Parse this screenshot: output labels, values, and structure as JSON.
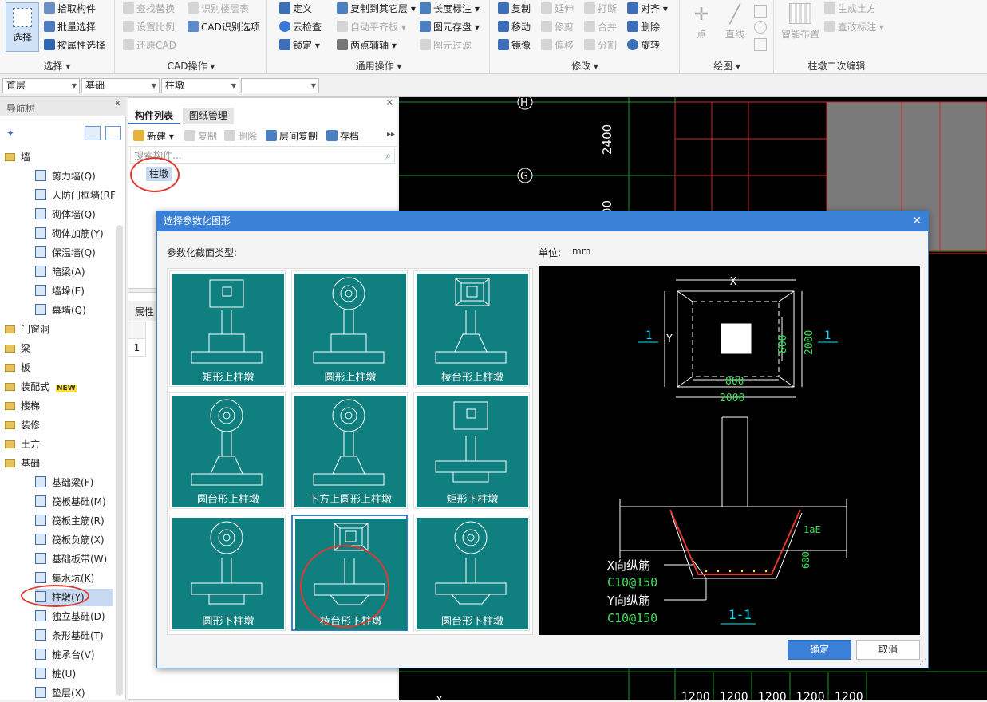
{
  "ribbon": {
    "select": {
      "big_label": "选择",
      "items": [
        "拾取构件",
        "批量选择",
        "按属性选择"
      ],
      "group": "选择"
    },
    "cad": {
      "items": [
        "查找替换",
        "识别楼层表",
        "设置比例",
        "CAD识别选项",
        "还原CAD"
      ],
      "group": "CAD操作"
    },
    "common": {
      "items": [
        "定义",
        "复制到其它层",
        "长度标注",
        "云检查",
        "自动平齐板",
        "图元存盘",
        "锁定",
        "两点辅轴",
        "图元过滤"
      ],
      "group": "通用操作"
    },
    "modify": {
      "items": [
        "复制",
        "延伸",
        "打断",
        "对齐",
        "移动",
        "修剪",
        "合并",
        "删除",
        "镜像",
        "偏移",
        "分割",
        "旋转"
      ],
      "group": "修改"
    },
    "draw": {
      "items": [
        "点",
        "直线"
      ],
      "group": "绘图"
    },
    "secondary": {
      "items": [
        "智能布置",
        "生成土方",
        "查改标注"
      ],
      "group": "柱墩二次编辑"
    }
  },
  "selectors": [
    "首层",
    "基础",
    "柱墩",
    ""
  ],
  "nav": {
    "title": "导航树",
    "items": [
      {
        "label": "墙",
        "type": "folder"
      },
      {
        "label": "剪力墙(Q)",
        "type": "sub"
      },
      {
        "label": "人防门框墙(RF",
        "type": "sub"
      },
      {
        "label": "砌体墙(Q)",
        "type": "sub"
      },
      {
        "label": "砌体加筋(Y)",
        "type": "sub"
      },
      {
        "label": "保温墙(Q)",
        "type": "sub"
      },
      {
        "label": "暗梁(A)",
        "type": "sub"
      },
      {
        "label": "墙垛(E)",
        "type": "sub"
      },
      {
        "label": "幕墙(Q)",
        "type": "sub"
      },
      {
        "label": "门窗洞",
        "type": "folder"
      },
      {
        "label": "梁",
        "type": "folder"
      },
      {
        "label": "板",
        "type": "folder"
      },
      {
        "label": "装配式",
        "type": "folder",
        "badge": "NEW"
      },
      {
        "label": "楼梯",
        "type": "folder"
      },
      {
        "label": "装修",
        "type": "folder"
      },
      {
        "label": "土方",
        "type": "folder"
      },
      {
        "label": "基础",
        "type": "folder"
      },
      {
        "label": "基础梁(F)",
        "type": "sub"
      },
      {
        "label": "筏板基础(M)",
        "type": "sub"
      },
      {
        "label": "筏板主筋(R)",
        "type": "sub"
      },
      {
        "label": "筏板负筋(X)",
        "type": "sub"
      },
      {
        "label": "基础板带(W)",
        "type": "sub"
      },
      {
        "label": "集水坑(K)",
        "type": "sub"
      },
      {
        "label": "柱墩(Y)",
        "type": "sub",
        "selected": true
      },
      {
        "label": "独立基础(D)",
        "type": "sub"
      },
      {
        "label": "条形基础(T)",
        "type": "sub"
      },
      {
        "label": "桩承台(V)",
        "type": "sub"
      },
      {
        "label": "桩(U)",
        "type": "sub"
      },
      {
        "label": "垫层(X)",
        "type": "sub"
      }
    ]
  },
  "comp": {
    "tabs": [
      "构件列表",
      "图纸管理"
    ],
    "toolbar": [
      "新建",
      "复制",
      "删除",
      "层间复制",
      "存档"
    ],
    "search_placeholder": "搜索构件...",
    "item": "柱墩"
  },
  "prop": {
    "header": "属性",
    "row": "1"
  },
  "canvas": {
    "axis_h": "H",
    "axis_g": "G",
    "dim_2400": "2400",
    "dim_00": "00",
    "dims_bottom": [
      "1200",
      "1200",
      "1200",
      "1200",
      "1200"
    ],
    "x": "X"
  },
  "dialog": {
    "title": "选择参数化图形",
    "section_label": "参数化截面类型:",
    "unit_label": "单位:",
    "unit_value": "mm",
    "shapes": [
      "矩形上柱墩",
      "圆形上柱墩",
      "棱台形上柱墩",
      "圆台形上柱墩",
      "下方上圆形上柱墩",
      "矩形下柱墩",
      "圆形下柱墩",
      "棱台形下柱墩",
      "圆台形下柱墩"
    ],
    "selected_index": 7,
    "preview": {
      "x": "X",
      "y": "Y",
      "d800a": "800",
      "d2000a": "2000",
      "d800b": "800",
      "d2000b": "2000",
      "sec": "1",
      "lae": "1aE",
      "d600": "600",
      "xbar": "X向纵筋",
      "xbarv": "C10@150",
      "ybar": "Y向纵筋",
      "ybarv": "C10@150",
      "title": "1-1"
    },
    "ok": "确定",
    "cancel": "取消"
  }
}
